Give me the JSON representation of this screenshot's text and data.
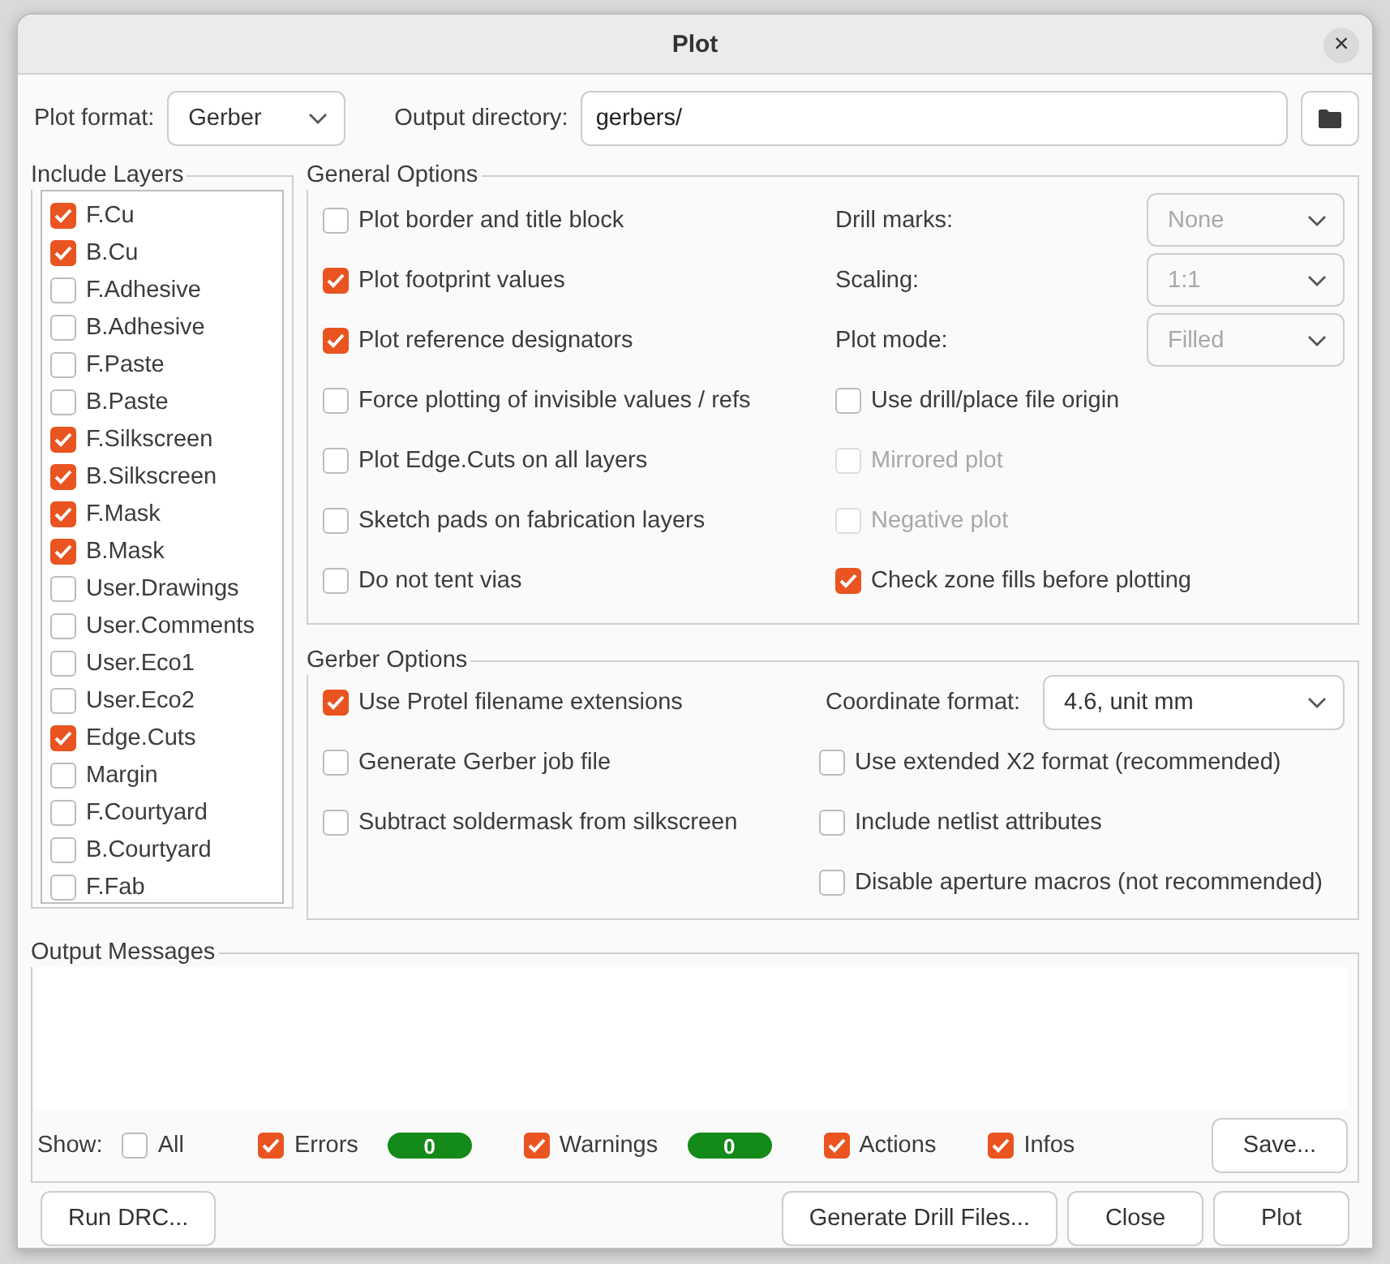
{
  "window": {
    "title": "Plot",
    "close": "×"
  },
  "plot_format": {
    "label": "Plot format:",
    "value": "Gerber"
  },
  "output_directory": {
    "label": "Output directory:",
    "value": "gerbers/"
  },
  "include_layers": {
    "title": "Include Layers",
    "layers": [
      {
        "label": "F.Cu",
        "checked": true
      },
      {
        "label": "B.Cu",
        "checked": true
      },
      {
        "label": "F.Adhesive",
        "checked": false
      },
      {
        "label": "B.Adhesive",
        "checked": false
      },
      {
        "label": "F.Paste",
        "checked": false
      },
      {
        "label": "B.Paste",
        "checked": false
      },
      {
        "label": "F.Silkscreen",
        "checked": true
      },
      {
        "label": "B.Silkscreen",
        "checked": true
      },
      {
        "label": "F.Mask",
        "checked": true
      },
      {
        "label": "B.Mask",
        "checked": true
      },
      {
        "label": "User.Drawings",
        "checked": false
      },
      {
        "label": "User.Comments",
        "checked": false
      },
      {
        "label": "User.Eco1",
        "checked": false
      },
      {
        "label": "User.Eco2",
        "checked": false
      },
      {
        "label": "Edge.Cuts",
        "checked": true
      },
      {
        "label": "Margin",
        "checked": false
      },
      {
        "label": "F.Courtyard",
        "checked": false
      },
      {
        "label": "B.Courtyard",
        "checked": false
      },
      {
        "label": "F.Fab",
        "checked": false
      }
    ]
  },
  "general_options": {
    "title": "General Options",
    "left_options": [
      {
        "label": "Plot border and title block",
        "checked": false
      },
      {
        "label": "Plot footprint values",
        "checked": true
      },
      {
        "label": "Plot reference designators",
        "checked": true
      },
      {
        "label": "Force plotting of invisible values / refs",
        "checked": false
      },
      {
        "label": "Plot Edge.Cuts on all layers",
        "checked": false
      },
      {
        "label": "Sketch pads on fabrication layers",
        "checked": false
      },
      {
        "label": "Do not tent vias",
        "checked": false
      }
    ],
    "dropdowns": [
      {
        "label": "Drill marks:",
        "value": "None",
        "disabled": true
      },
      {
        "label": "Scaling:",
        "value": "1:1",
        "disabled": true
      },
      {
        "label": "Plot mode:",
        "value": "Filled",
        "disabled": true
      }
    ],
    "right_options": [
      {
        "label": "Use drill/place file origin",
        "checked": false,
        "disabled": false
      },
      {
        "label": "Mirrored plot",
        "checked": false,
        "disabled": true
      },
      {
        "label": "Negative plot",
        "checked": false,
        "disabled": true
      },
      {
        "label": "Check zone fills before plotting",
        "checked": true,
        "disabled": false
      }
    ]
  },
  "gerber_options": {
    "title": "Gerber Options",
    "left_options": [
      {
        "label": "Use Protel filename extensions",
        "checked": true
      },
      {
        "label": "Generate Gerber job file",
        "checked": false
      },
      {
        "label": "Subtract soldermask from silkscreen",
        "checked": false
      }
    ],
    "coordinate_format": {
      "label": "Coordinate format:",
      "value": "4.6, unit mm"
    },
    "right_options": [
      {
        "label": "Use extended X2 format (recommended)",
        "checked": false
      },
      {
        "label": "Include netlist attributes",
        "checked": false
      },
      {
        "label": "Disable aperture macros (not recommended)",
        "checked": false
      }
    ]
  },
  "output_messages": {
    "title": "Output Messages",
    "show_label": "Show:",
    "filters": [
      {
        "label": "All",
        "checked": false
      },
      {
        "label": "Errors",
        "checked": true,
        "count": "0"
      },
      {
        "label": "Warnings",
        "checked": true,
        "count": "0"
      },
      {
        "label": "Actions",
        "checked": true
      },
      {
        "label": "Infos",
        "checked": true
      }
    ],
    "save_button": "Save..."
  },
  "buttons_left": [
    "Run DRC..."
  ],
  "buttons_right": [
    "Generate Drill Files...",
    "Close",
    "Plot"
  ]
}
